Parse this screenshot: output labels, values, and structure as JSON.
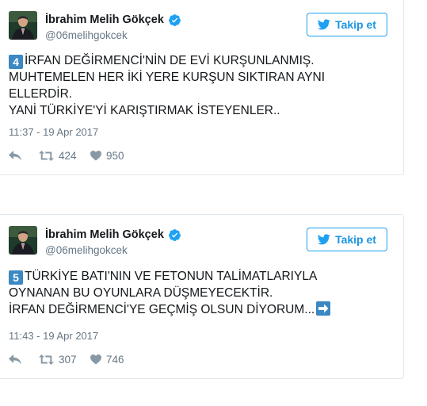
{
  "tweets": [
    {
      "author": {
        "display_name": "İbrahim Melih Gökçek",
        "handle": "@06melihgokcek",
        "verified": true
      },
      "follow_button_label": "Takip et",
      "number_badge": "4",
      "text": "İRFAN DEĞİRMENCİ'NİN DE EVİ KURŞUNLANMIŞ.\nMUHTEMELEN HER İKİ YERE KURŞUN SIKTIRAN AYNI\nELLERDİR.\nYANİ TÜRKİYE'Yİ KARIŞTIRMAK İSTEYENLER..",
      "timestamp": "11:37 - 19 Apr 2017",
      "retweets": "424",
      "likes": "950"
    },
    {
      "author": {
        "display_name": "İbrahim Melih Gökçek",
        "handle": "@06melihgokcek",
        "verified": true
      },
      "follow_button_label": "Takip et",
      "number_badge": "5",
      "text": "TÜRKİYE BATI'NIN VE FETONUN TALİMATLARIYLA\nOYNANAN BU OYUNLARA DÜŞMEYECEKTİR.\nİRFAN DEĞİRMENCİ'YE GEÇMİŞ OLSUN DİYORUM...",
      "trailing_emoji": "right-arrow-emoji",
      "timestamp": "11:43 - 19 Apr 2017",
      "retweets": "307",
      "likes": "746"
    }
  ],
  "colors": {
    "accent": "#1da1f2",
    "text": "#14171a",
    "muted": "#657786",
    "border": "#e1e8ed",
    "keycap": "#3b88c3"
  }
}
